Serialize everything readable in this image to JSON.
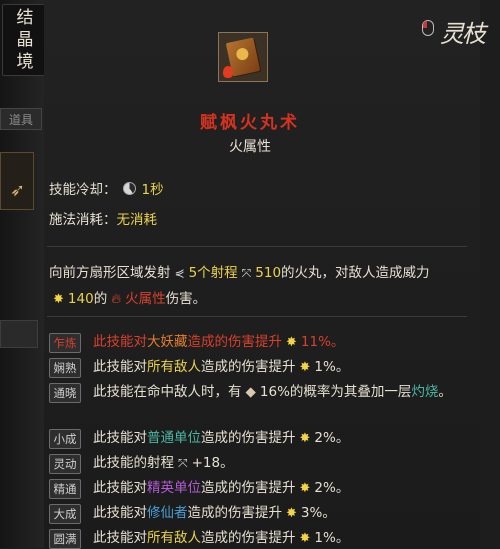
{
  "sidebar": {
    "realm_chars": [
      "结",
      "晶",
      "境"
    ],
    "items_tab": "道具"
  },
  "logo": {
    "text": "灵枝"
  },
  "skill": {
    "name": "赋枫火丸术",
    "attribute": "火属性",
    "cooldown_label": "技能冷却：",
    "cooldown_value": "1秒",
    "cost_label": "施法消耗：",
    "cost_value": "无消耗"
  },
  "description": {
    "part1": "向前方扇形区域发射",
    "count": "5个射程",
    "range": "510",
    "part2": "的火丸，对敌人造成威力",
    "power": "140",
    "part3": "的",
    "element": "火属性",
    "part4": "伤害。"
  },
  "bonuses": [
    {
      "badge": "乍炼",
      "pre": "此技能对",
      "target": "大妖藏",
      "post": "造成的伤害提升",
      "icon": "sun",
      "value": "11%。",
      "target_color": "#e67f2c"
    },
    {
      "badge": "娴熟",
      "pre": "此技能对",
      "target": "所有敌人",
      "post": "造成的伤害提升",
      "icon": "sun",
      "value": "1%。",
      "target_color": "#e9d24a"
    },
    {
      "badge": "通晓",
      "pre": "此技能在命中敌人时，有",
      "target": "",
      "post": "16%的概率为其叠加一层",
      "icon": "gem",
      "value": "灼烧",
      "tail": "。",
      "target_color": "#48b8a5"
    },
    {
      "badge": "小成",
      "pre": "此技能对",
      "target": "普通单位",
      "post": "造成的伤害提升",
      "icon": "sun",
      "value": "2%。",
      "target_color": "#48b8a5"
    },
    {
      "badge": "灵动",
      "pre": "此技能的射程",
      "target": "",
      "post": "",
      "icon": "arrows",
      "value": "+18。",
      "target_color": "#e6e0d2"
    },
    {
      "badge": "精通",
      "pre": "此技能对",
      "target": "精英单位",
      "post": "造成的伤害提升",
      "icon": "sun",
      "value": "2%。",
      "target_color": "#b45bd8"
    },
    {
      "badge": "大成",
      "pre": "此技能对",
      "target": "修仙者",
      "post": "造成的伤害提升",
      "icon": "sun",
      "value": "3%。",
      "target_color": "#4b9fd8"
    },
    {
      "badge": "圆满",
      "pre": "此技能对",
      "target": "所有敌人",
      "post": "造成的伤害提升",
      "icon": "sun",
      "value": "1%。",
      "target_color": "#e9d24a"
    }
  ]
}
